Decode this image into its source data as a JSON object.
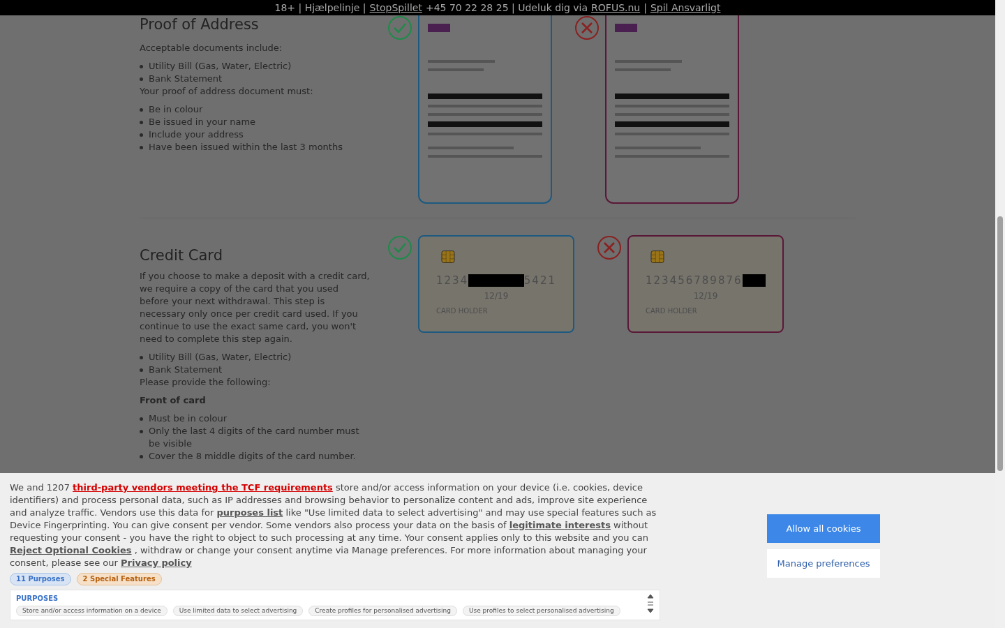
{
  "top_bar": [
    {
      "kind": "text",
      "text": "18+ | Hjælpelinje |"
    },
    {
      "kind": "link",
      "text": "StopSpillet"
    },
    {
      "kind": "text",
      "text": "+45 70 22 28 25 | Udeluk dig via"
    },
    {
      "kind": "link",
      "text": "ROFUS.nu"
    },
    {
      "kind": "text",
      "text": "|"
    },
    {
      "kind": "link",
      "text": "Spil Ansvarligt"
    }
  ],
  "sections": [
    {
      "title": "Proof of Address",
      "blocks": [
        {
          "kind": "paragraph",
          "text": "Acceptable documents include:"
        },
        {
          "kind": "list",
          "items": [
            "Utility Bill (Gas, Water, Electric)",
            "Bank Statement"
          ]
        },
        {
          "kind": "note",
          "text": "Your proof of address document must:"
        },
        {
          "kind": "list",
          "items": [
            "Be in colour",
            "Be issued in your name",
            "Include your address",
            "Have been issued within the last 3 months"
          ]
        }
      ],
      "examples": [
        {
          "kind": "document",
          "acceptable": true
        },
        {
          "kind": "document",
          "acceptable": false
        }
      ]
    },
    {
      "title": "Credit Card",
      "blocks": [
        {
          "kind": "paragraph",
          "text": "If you choose to make a deposit with a credit card, we require a copy of the card that you used before your next withdrawal. This step is necessary only once per credit card used. If you continue to use the exact same card, you won't need to complete this step again."
        },
        {
          "kind": "list",
          "items": [
            "Utility Bill (Gas, Water, Electric)",
            "Bank Statement"
          ]
        },
        {
          "kind": "note",
          "text": "Please provide the following:"
        },
        {
          "kind": "subheading",
          "text": "Front of card"
        },
        {
          "kind": "list",
          "items": [
            "Must be in colour",
            "Only the last 4 digits of the card number must be visible",
            "Cover the 8 middle digits of the card number."
          ]
        }
      ],
      "examples": [
        {
          "kind": "card",
          "acceptable": true,
          "digits_before": "1234",
          "digits_after": "5421",
          "expiry": "12/19",
          "holder": "CARD HOLDER"
        },
        {
          "kind": "card",
          "acceptable": false,
          "digits_before": "123456789876",
          "expiry": "12/19",
          "holder": "CARD HOLDER"
        }
      ]
    }
  ],
  "cookie_banner": {
    "text_parts": [
      {
        "kind": "text",
        "text": "We and 1207"
      },
      {
        "kind": "vendor_link",
        "text": "third-party vendors meeting the TCF requirements"
      },
      {
        "kind": "text",
        "text": "store and/or access information on your device (i.e. cookies, device identifiers) and process personal data, such as IP addresses and browsing behavior to personalize content and ads, improve site experience and analyze traffic. Vendors use this data for"
      },
      {
        "kind": "link",
        "text": "purposes list"
      },
      {
        "kind": "text",
        "text": " like \"Use limited data to select advertising\" and may use special features such as Device Fingerprinting. You can give consent per vendor. Some vendors also process your data on the basis of"
      },
      {
        "kind": "link",
        "text": "legitimate interests"
      },
      {
        "kind": "text",
        "text": " without requesting your consent - you have the right to object to such processing at any time. Your consent applies only to this website and you can"
      },
      {
        "kind": "link",
        "text": "Reject Optional Cookies"
      },
      {
        "kind": "text",
        "text": ", withdraw or change your consent anytime via Manage preferences. For more information about managing your consent, please see our"
      },
      {
        "kind": "link",
        "text": "Privacy policy"
      }
    ],
    "tags": [
      {
        "kind": "purposes",
        "text": "11 Purposes"
      },
      {
        "kind": "special",
        "text": "2 Special Features"
      }
    ],
    "purposes": {
      "title": "PURPOSES",
      "items": [
        "Store and/or access information on a device",
        "Use limited data to select advertising",
        "Create profiles for personalised advertising",
        "Use profiles to select personalised advertising"
      ]
    },
    "buttons": [
      {
        "kind": "primary",
        "label": "Allow all cookies"
      },
      {
        "kind": "secondary",
        "label": "Manage preferences"
      }
    ]
  }
}
